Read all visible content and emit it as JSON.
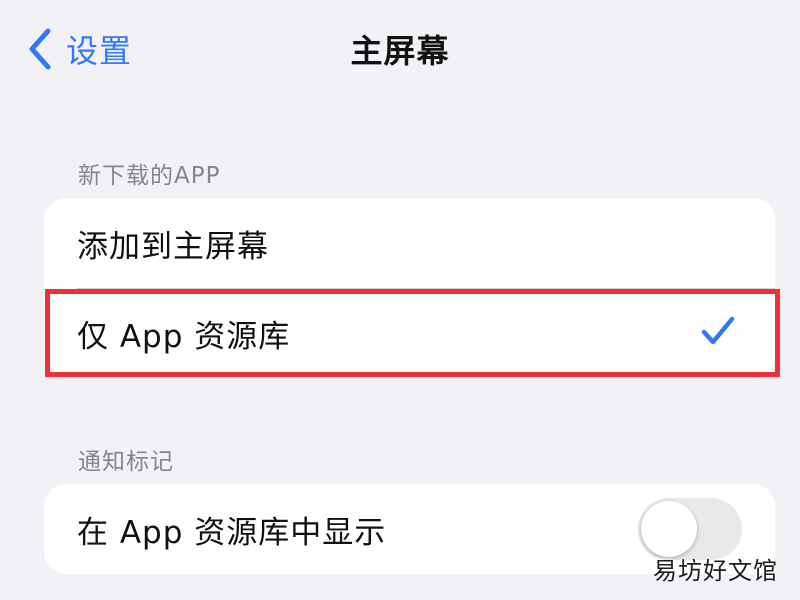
{
  "nav": {
    "back_label": "设置",
    "title": "主屏幕"
  },
  "sections": [
    {
      "header": "新下载的APP",
      "rows": [
        {
          "label": "添加到主屏幕",
          "selected": false
        },
        {
          "label": "仅 App 资源库",
          "selected": true
        }
      ]
    },
    {
      "header": "通知标记",
      "rows": [
        {
          "label": "在 App 资源库中显示",
          "toggle_on": false
        }
      ]
    }
  ],
  "watermark": "易坊好文馆",
  "colors": {
    "accent": "#3478f6",
    "background": "#f1f1f6",
    "card": "#ffffff",
    "secondary_text": "#85858b",
    "highlight": "#ec3238",
    "toggle_off": "#e9e9ea"
  },
  "icons": {
    "back": "chevron-left-icon",
    "selected": "checkmark-icon"
  }
}
